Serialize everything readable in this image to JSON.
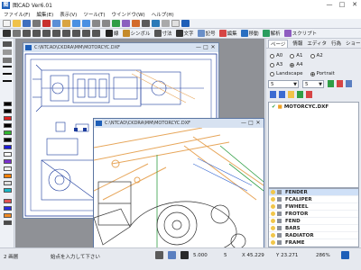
{
  "window": {
    "title": "图CAD Ver6.01",
    "minimize": "—",
    "maximize": "□",
    "close": "✕"
  },
  "menu": [
    "ファイル(F)",
    "編集(E)",
    "表示(V)",
    "ツール(T)",
    "ウインドウ(W)",
    "ヘルプ(H)"
  ],
  "toolbar2": [
    {
      "icon": "pen-icon",
      "label": "線"
    },
    {
      "icon": "symbol-icon",
      "label": "シンボル"
    },
    {
      "icon": "dimension-icon",
      "label": "寸法"
    },
    {
      "icon": "text-icon",
      "label": "文字"
    },
    {
      "icon": "image-icon",
      "label": "記号"
    },
    {
      "icon": "edit-icon",
      "label": "編集"
    },
    {
      "icon": "move-icon",
      "label": "移動"
    },
    {
      "icon": "analyze-icon",
      "label": "解析"
    },
    {
      "icon": "script-icon",
      "label": "スクリプト"
    }
  ],
  "outer_doc": {
    "title": "C:\\NTCAD\\CKDRA\\MM\\MOTORCYC.DXF"
  },
  "inner_doc": {
    "title": "C:\\NTCAD\\CKDRA\\MM\\MOTORCYC.DXF"
  },
  "rpanel": {
    "tabs": [
      "ページ",
      "情報",
      "エディタ",
      "行為",
      "ショート"
    ],
    "size_options": [
      "A0",
      "A1",
      "A2",
      "A3",
      "A4"
    ],
    "size_selected": "A4",
    "orientation": {
      "landscape": "Landscape",
      "portrait": "Portrait",
      "selected": "portrait"
    },
    "select1": "5",
    "select2": "5",
    "files": [
      "MOTORCYC.DXF"
    ],
    "layers": [
      "FENDER",
      "FCALIPER",
      "FWHEEL",
      "FROTOR",
      "FEND",
      "BARS",
      "RADIATOR",
      "FRAME"
    ]
  },
  "status": {
    "left": "2 画層",
    "hint": "始点を入力して下さい",
    "scale": "5.000",
    "step": "5",
    "x": "X 45.229",
    "y": "Y 23.271",
    "zoom": "286%"
  },
  "colors": {
    "accent": "#1e5fb8",
    "cad_blue": "#1b3a9c",
    "cad_orange": "#e7a65a",
    "cad_green": "#2f9e45"
  }
}
